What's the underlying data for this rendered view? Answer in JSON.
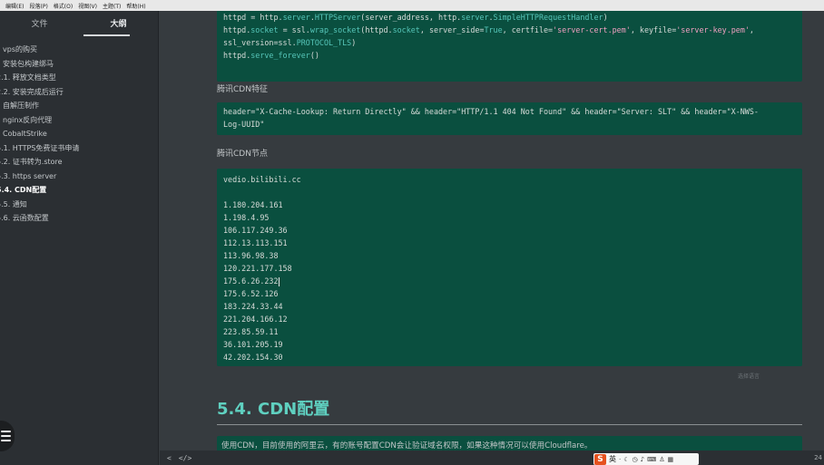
{
  "menubar": [
    "编辑(E)",
    "段落(P)",
    "格式(O)",
    "视图(V)",
    "主题(T)",
    "帮助(H)"
  ],
  "sidebar": {
    "tabs": [
      "文件",
      "大纲"
    ],
    "active_tab": 1,
    "items": [
      {
        "label": "vps的购买",
        "level": 0
      },
      {
        "label": "安装包构建绑马",
        "level": 0
      },
      {
        "label": "2.1. 释放文档类型",
        "level": 1
      },
      {
        "label": "2.2. 安装完成后运行",
        "level": 1
      },
      {
        "label": "自解压制作",
        "level": 0
      },
      {
        "label": "nginx反向代理",
        "level": 0
      },
      {
        "label": "CobaltStrike",
        "level": 0
      },
      {
        "label": "5.1. HTTPS免费证书申请",
        "level": 1
      },
      {
        "label": "5.2. 证书转为.store",
        "level": 1
      },
      {
        "label": "5.3. https server",
        "level": 1
      },
      {
        "label": "5.4. CDN配置",
        "level": 1,
        "active": true
      },
      {
        "label": "5.5. 通知",
        "level": 1
      },
      {
        "label": "5.6. 云函数配置",
        "level": 1
      }
    ]
  },
  "content": {
    "code_block_1": {
      "line1": {
        "a": "httpd = http.",
        "b": "server",
        "c": ".",
        "d": "HTTPServer",
        "e": "(server_address, http.",
        "f": "server",
        "g": ".",
        "h": "SimpleHTTPRequestHandler",
        "i": ")"
      },
      "line2": {
        "a": "httpd.",
        "b": "socket",
        "c": " = ssl.",
        "d": "wrap_socket",
        "e": "(httpd.",
        "f": "socket",
        "g": ", server_side=",
        "h": "True",
        "i": ", certfile=",
        "j": "'server-cert.pem'",
        "k": ", keyfile=",
        "l": "'server-key.pem'",
        "m": ","
      },
      "line3": {
        "a": "ssl_version=ssl.",
        "b": "PROTOCOL_TLS",
        "c": ")"
      },
      "line4": {
        "a": "httpd.",
        "b": "serve_forever",
        "c": "()"
      }
    },
    "cdn_signature_label": "腾讯CDN特征",
    "cdn_signature_code": "header=\"X-Cache-Lookup: Return Directly\" && header=\"HTTP/1.1 404 Not Found\" && header=\"Server: SLT\" && header=\"X-NWS-\nLog-UUID\"",
    "cdn_nodes_label": "腾讯CDN节点",
    "cdn_nodes_domain": "vedio.bilibili.cc",
    "cdn_nodes_ips": [
      "1.180.204.161",
      "1.198.4.95",
      "106.117.249.36",
      "112.13.113.151",
      "113.96.98.38",
      "120.221.177.158",
      "175.6.26.232",
      "175.6.52.126",
      "183.224.33.44",
      "221.204.166.12",
      "223.85.59.11",
      "36.101.205.19",
      "42.202.154.30"
    ],
    "cursor_after_index": 6,
    "code_caption": "选择语言",
    "section_heading": "5.4. CDN配置",
    "intro_text": "使用CDN，目前使用的阿里云，有的账号配置CDN会让验证域名权限，如果这种情况可以使用Cloudflare。"
  },
  "statusbar": {
    "back_label": "<",
    "source_label": "</>",
    "word_count": "24"
  },
  "ime": {
    "logo": "S",
    "lang": "英",
    "icons": [
      "dot-icon",
      "moon-icon",
      "clock-icon",
      "mic-icon",
      "keyboard-icon",
      "shirt-icon",
      "grid-icon"
    ]
  },
  "colors": {
    "code_bg": "#0a4f3f",
    "heading": "#5fd0c0",
    "sidebar_bg": "#2b2f33",
    "editor_bg": "#363b3f"
  }
}
